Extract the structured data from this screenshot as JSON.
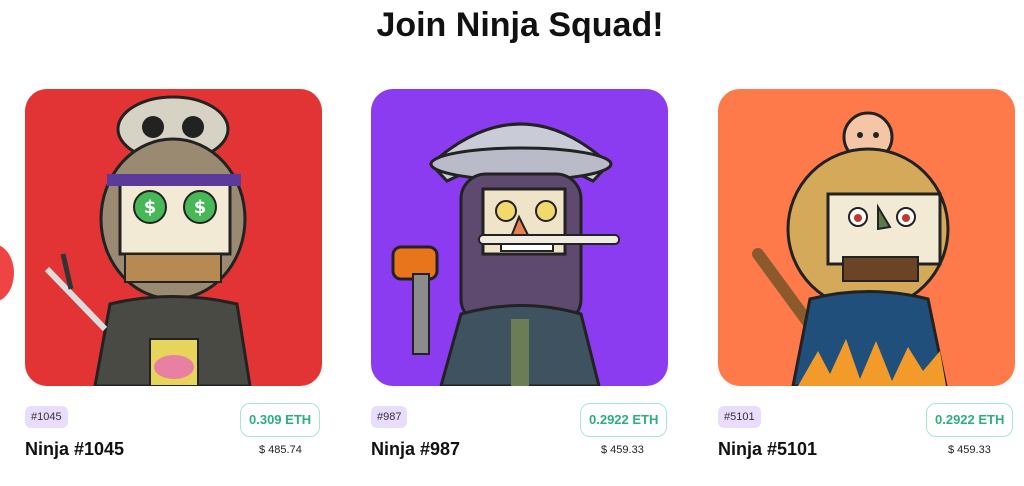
{
  "page": {
    "title": "Join Ninja Squad!"
  },
  "cards": [
    {
      "id_label": "#1045",
      "price": "0.309 ETH",
      "name": "Ninja #1045",
      "usd": "$ 485.74",
      "bg": "#e23434"
    },
    {
      "id_label": "#987",
      "price": "0.2922 ETH",
      "name": "Ninja #987",
      "usd": "$ 459.33",
      "bg": "#8b3cf0"
    },
    {
      "id_label": "#5101",
      "price": "0.2922 ETH",
      "name": "Ninja #5101",
      "usd": "$ 459.33",
      "bg": "#ff7a4a"
    }
  ],
  "colors": {
    "accent": "#ef4444",
    "price_green": "#2bb07a",
    "badge_bg": "#e9ddff"
  },
  "icons": {
    "prev": "carousel-prev-arrow"
  }
}
